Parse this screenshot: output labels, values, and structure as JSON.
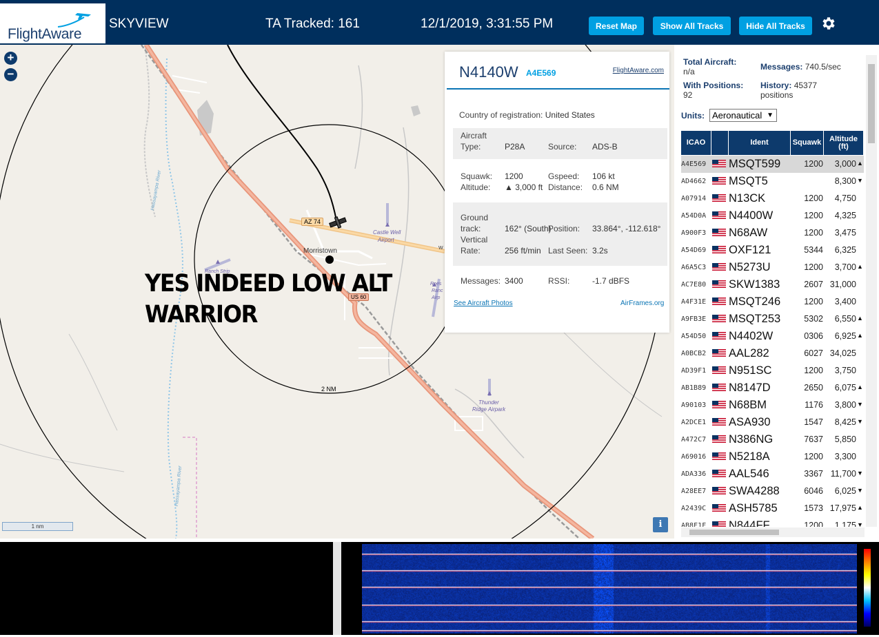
{
  "header": {
    "logo_text": "FlightAware",
    "app_name": "SKYVIEW",
    "ta_tracked": "TA Tracked: 161",
    "datetime": "12/1/2019, 3:31:55 PM",
    "buttons": {
      "reset_map": "Reset Map",
      "show_all": "Show All Tracks",
      "hide_all": "Hide All Tracks"
    },
    "settings_icon": "gear-icon"
  },
  "map": {
    "zoom_in": "+",
    "zoom_out": "−",
    "overlay_line1": "YES INDEED LOW ALT",
    "overlay_line2": "WARRIOR",
    "scale_label": "1 nm",
    "ring_label": "2 NM",
    "info_button": "i",
    "places": {
      "town": "Morristown",
      "az74": "AZ 74",
      "us60": "US 60",
      "castle_well": "Castle Well",
      "castle_well_2": "Airport",
      "thunder_ridge": "Thunder",
      "thunder_ridge_2": "Ridge Airpark",
      "ranch_strip": "Ranch Strip",
      "river": "Hassayampa River",
      "roes1": "Roes",
      "roes2": "Ranc",
      "roes3": "Airp",
      "w": "W"
    }
  },
  "popup": {
    "callsign": "N4140W",
    "hex": "A4E569",
    "fa_link": "FlightAware.com",
    "country_label": "Country of registration:",
    "country": "United States",
    "aircraft_label": "Aircraft",
    "type_label": "Type:",
    "type": "P28A",
    "source_label": "Source:",
    "source": "ADS-B",
    "squawk_label": "Squawk:",
    "squawk": "1200",
    "gspeed_label": "Gspeed:",
    "gspeed": "106 kt",
    "altitude_label": "Altitude:",
    "altitude": "▲ 3,000 ft",
    "distance_label": "Distance:",
    "distance": "0.6 NM",
    "ground_label": "Ground",
    "track_label": "track:",
    "track": "162° (South)",
    "position_label": "Position:",
    "position": "33.864°, -112.618°",
    "vertical_label": "Vertical",
    "rate_label": "Rate:",
    "rate": "256 ft/min",
    "last_seen_label": "Last Seen:",
    "last_seen": "3.2s",
    "messages_label": "Messages:",
    "messages": "3400",
    "rssi_label": "RSSI:",
    "rssi": "-1.7 dBFS",
    "photos_link": "See Aircraft Photos",
    "airframes_link": "AirFrames.org"
  },
  "sidebar": {
    "total_label": "Total Aircraft:",
    "total_value": "n/a",
    "messages_label": "Messages:",
    "messages_value": "740.5/sec",
    "positions_label": "With Positions:",
    "positions_value": "92",
    "history_label": "History:",
    "history_value": "45377",
    "history_unit": "positions",
    "units_label": "Units:",
    "units_value": "Aeronautical",
    "columns": [
      "ICAO",
      "",
      "Ident",
      "Squawk",
      "Altitude (ft)"
    ],
    "rows": [
      {
        "icao": "A4E569",
        "ident": "MSQT599",
        "squawk": "1200",
        "alt": "3,000",
        "vr": "▲"
      },
      {
        "icao": "AD4662",
        "ident": "MSQT5",
        "squawk": "",
        "alt": "8,300",
        "vr": "▼"
      },
      {
        "icao": "A07914",
        "ident": "N13CK",
        "squawk": "1200",
        "alt": "4,750",
        "vr": ""
      },
      {
        "icao": "A54D0A",
        "ident": "N4400W",
        "squawk": "1200",
        "alt": "4,325",
        "vr": ""
      },
      {
        "icao": "A900F3",
        "ident": "N68AW",
        "squawk": "1200",
        "alt": "3,475",
        "vr": ""
      },
      {
        "icao": "A54D69",
        "ident": "OXF121",
        "squawk": "5344",
        "alt": "6,325",
        "vr": ""
      },
      {
        "icao": "A6A5C3",
        "ident": "N5273U",
        "squawk": "1200",
        "alt": "3,700",
        "vr": "▲"
      },
      {
        "icao": "AC7E80",
        "ident": "SKW1383",
        "squawk": "2607",
        "alt": "31,000",
        "vr": ""
      },
      {
        "icao": "A4F31E",
        "ident": "MSQT246",
        "squawk": "1200",
        "alt": "3,400",
        "vr": ""
      },
      {
        "icao": "A9FB3E",
        "ident": "MSQT253",
        "squawk": "5302",
        "alt": "6,550",
        "vr": "▲"
      },
      {
        "icao": "A54D50",
        "ident": "N4402W",
        "squawk": "0306",
        "alt": "6,925",
        "vr": "▲"
      },
      {
        "icao": "A0BCB2",
        "ident": "AAL282",
        "squawk": "6027",
        "alt": "34,025",
        "vr": ""
      },
      {
        "icao": "AD39F1",
        "ident": "N951SC",
        "squawk": "1200",
        "alt": "3,750",
        "vr": ""
      },
      {
        "icao": "AB1B89",
        "ident": "N8147D",
        "squawk": "2650",
        "alt": "6,075",
        "vr": "▲"
      },
      {
        "icao": "A90103",
        "ident": "N68BM",
        "squawk": "1176",
        "alt": "3,800",
        "vr": "▼"
      },
      {
        "icao": "A2DCE1",
        "ident": "ASA930",
        "squawk": "1547",
        "alt": "8,425",
        "vr": "▼"
      },
      {
        "icao": "A472C7",
        "ident": "N386NG",
        "squawk": "7637",
        "alt": "5,850",
        "vr": ""
      },
      {
        "icao": "A69016",
        "ident": "N5218A",
        "squawk": "1200",
        "alt": "3,300",
        "vr": ""
      },
      {
        "icao": "ADA336",
        "ident": "AAL546",
        "squawk": "3367",
        "alt": "11,700",
        "vr": "▼"
      },
      {
        "icao": "A28EE7",
        "ident": "SWA4288",
        "squawk": "6046",
        "alt": "6,025",
        "vr": "▼"
      },
      {
        "icao": "A2439C",
        "ident": "ASH5785",
        "squawk": "1573",
        "alt": "17,975",
        "vr": "▲"
      },
      {
        "icao": "AB8F1F",
        "ident": "N844FF",
        "squawk": "1200",
        "alt": "1,175",
        "vr": "▼"
      }
    ]
  },
  "colors": {
    "header_bg": "#002f5d",
    "button_bg": "#00a0e2",
    "table_header_bg": "#0d3a6c",
    "map_bg": "#f2efe9",
    "road": "#e8957a"
  }
}
